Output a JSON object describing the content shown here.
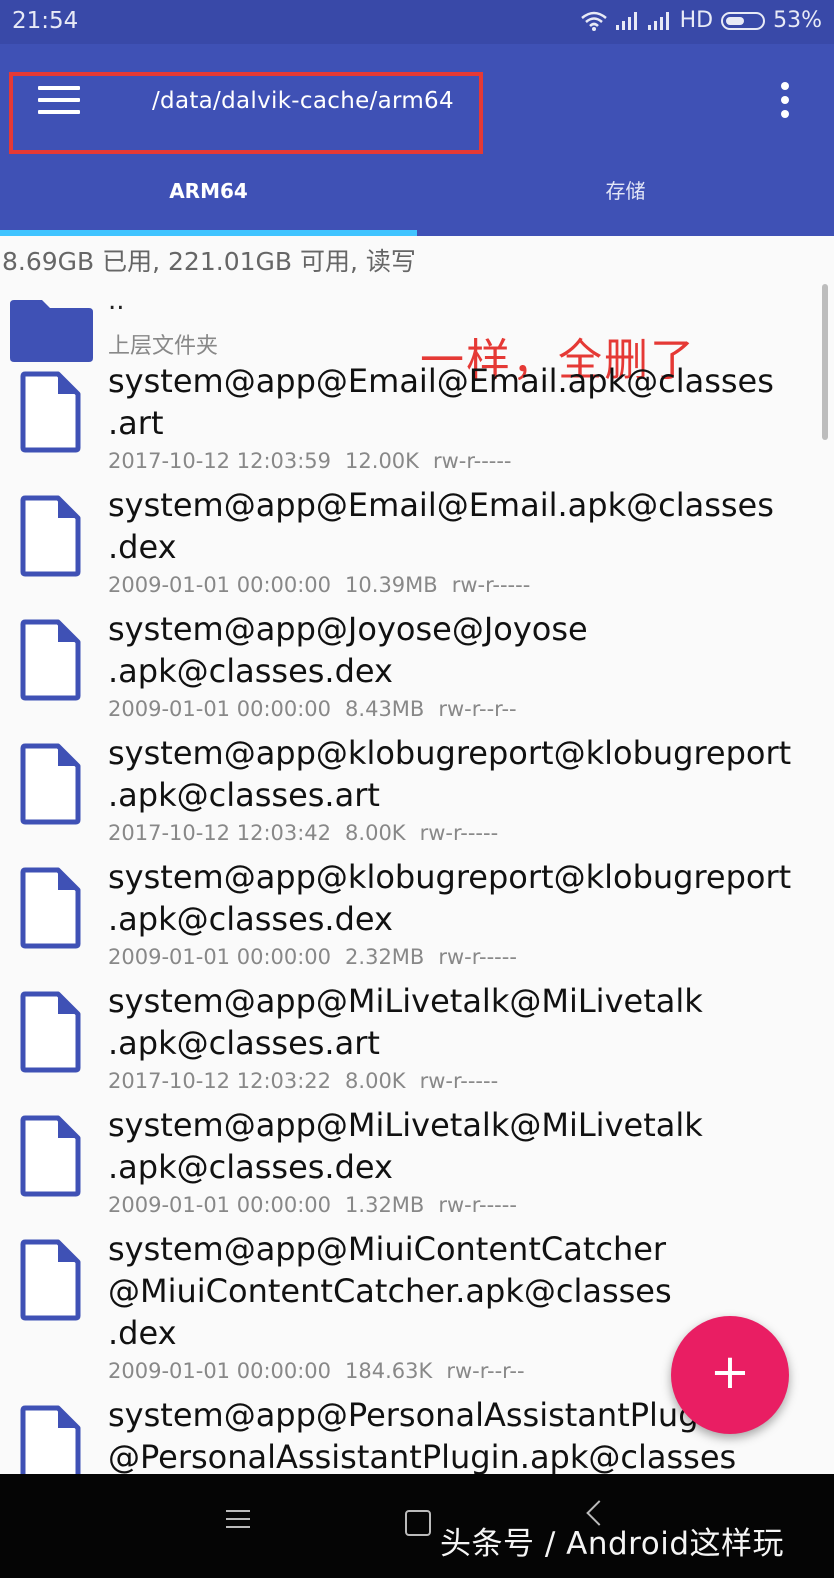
{
  "status_bar": {
    "time": "21:54",
    "network": "HD",
    "battery": "53%"
  },
  "app_bar": {
    "path": "/data/dalvik-cache/arm64",
    "tabs": [
      {
        "label": "ARM64",
        "active": true
      },
      {
        "label": "存储",
        "active": false
      }
    ]
  },
  "storage_info": "8.69GB 已用, 221.01GB 可用, 读写",
  "annotation": "一样，全删了",
  "parent_folder": {
    "name": "..",
    "label": "上层文件夹"
  },
  "files": [
    {
      "name": "system@app@Email@Email.apk@classes\n.art",
      "date": "2017-10-12 12:03:59",
      "size": "12.00K",
      "perm": "rw-r-----"
    },
    {
      "name": "system@app@Email@Email.apk@classes\n.dex",
      "date": "2009-01-01 00:00:00",
      "size": "10.39MB",
      "perm": "rw-r-----"
    },
    {
      "name": "system@app@Joyose@Joyose\n.apk@classes.dex",
      "date": "2009-01-01 00:00:00",
      "size": "8.43MB",
      "perm": "rw-r--r--"
    },
    {
      "name": "system@app@klobugreport@klobugreport\n.apk@classes.art",
      "date": "2017-10-12 12:03:42",
      "size": "8.00K",
      "perm": "rw-r-----"
    },
    {
      "name": "system@app@klobugreport@klobugreport\n.apk@classes.dex",
      "date": "2009-01-01 00:00:00",
      "size": "2.32MB",
      "perm": "rw-r-----"
    },
    {
      "name": "system@app@MiLivetalk@MiLivetalk\n.apk@classes.art",
      "date": "2017-10-12 12:03:22",
      "size": "8.00K",
      "perm": "rw-r-----"
    },
    {
      "name": "system@app@MiLivetalk@MiLivetalk\n.apk@classes.dex",
      "date": "2009-01-01 00:00:00",
      "size": "1.32MB",
      "perm": "rw-r-----"
    },
    {
      "name": "system@app@MiuiContentCatcher\n@MiuiContentCatcher.apk@classes\n.dex",
      "date": "2009-01-01 00:00:00",
      "size": "184.63K",
      "perm": "rw-r--r--"
    },
    {
      "name": "system@app@PersonalAssistantPlugin\n@PersonalAssistantPlugin.apk@classes",
      "date": "",
      "size": "",
      "perm": ""
    }
  ],
  "fab": {
    "label": "+"
  },
  "watermark": "头条号 / Android这样玩",
  "colors": {
    "primary": "#3f51b5",
    "status_bar": "#3949a8",
    "accent": "#e91e63",
    "tab_indicator": "#40c4ff",
    "annotation": "#e53935"
  }
}
